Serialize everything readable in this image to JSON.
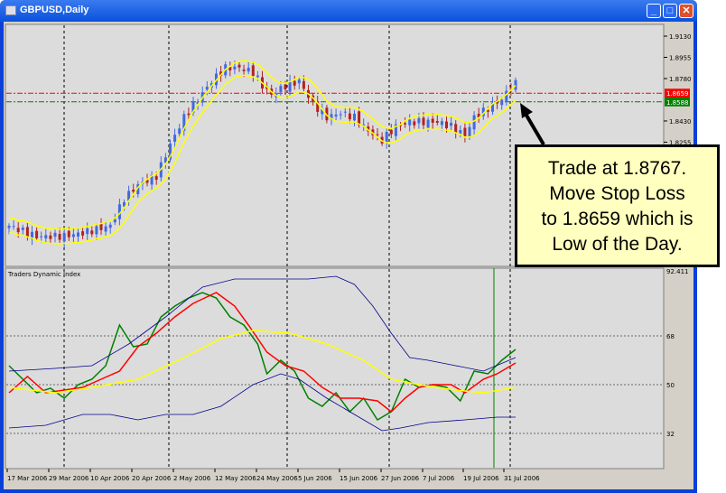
{
  "window": {
    "title": "GBPUSD,Daily",
    "buttons": [
      "minimize",
      "maximize",
      "close"
    ]
  },
  "price_axis": {
    "ticks": [
      "1.9130",
      "1.8955",
      "1.8780",
      "1.8430",
      "1.8255"
    ],
    "tick_values": [
      1.913,
      1.8955,
      1.878,
      1.843,
      1.8255
    ],
    "bid_label": "1.8659",
    "stop_label": "1.8588",
    "bid_color": "#ff0000",
    "stop_color": "#008000"
  },
  "indicator": {
    "name": "Traders Dynamic Index",
    "max_label": "92.411",
    "levels": [
      "68",
      "50",
      "32"
    ],
    "level_values": [
      68,
      50,
      32
    ]
  },
  "date_axis": [
    "17 Mar 2006",
    "29 Mar 2006",
    "10 Apr 2006",
    "20 Apr 2006",
    "2 May 2006",
    "12 May 2006",
    "24 May 2006",
    "5 Jun 2006",
    "15 Jun 2006",
    "27 Jun 2006",
    "7 Jul 2006",
    "19 Jul 2006",
    "31 Jul 2006"
  ],
  "callout": {
    "lines": [
      "Trade at 1.8767.",
      "Move Stop Loss",
      "to 1.8659 which is",
      "Low of the Day."
    ]
  },
  "colors": {
    "bull": "#4169e1",
    "bear": "#b22222",
    "bands": "#ffff00",
    "rsi": "#008000",
    "signal": "#ff0000",
    "market_base": "#ffff00",
    "volatility": "#00008b"
  },
  "chart_data": [
    {
      "type": "candlestick",
      "symbol": "GBPUSD",
      "timeframe": "Daily",
      "ylim": [
        1.74,
        1.92
      ],
      "close_path": [
        [
          0,
          1.7566
        ],
        [
          6,
          1.7476
        ],
        [
          12,
          1.748
        ],
        [
          16,
          1.7506
        ],
        [
          22,
          1.7566
        ],
        [
          25,
          1.7789
        ],
        [
          28,
          1.7901
        ],
        [
          32,
          1.7975
        ],
        [
          35,
          1.8236
        ],
        [
          38,
          1.846
        ],
        [
          41,
          1.8609
        ],
        [
          44,
          1.8758
        ],
        [
          47,
          1.8869
        ],
        [
          50,
          1.8869
        ],
        [
          53,
          1.8832
        ],
        [
          55,
          1.872
        ],
        [
          57,
          1.8646
        ],
        [
          60,
          1.872
        ],
        [
          63,
          1.8758
        ],
        [
          66,
          1.8571
        ],
        [
          69,
          1.846
        ],
        [
          72,
          1.8497
        ],
        [
          75,
          1.846
        ],
        [
          78,
          1.8348
        ],
        [
          81,
          1.8273
        ],
        [
          84,
          1.8385
        ],
        [
          87,
          1.8422
        ],
        [
          90,
          1.8422
        ],
        [
          93,
          1.8422
        ],
        [
          96,
          1.8385
        ],
        [
          99,
          1.8311
        ],
        [
          101,
          1.846
        ],
        [
          104,
          1.8534
        ],
        [
          107,
          1.8609
        ],
        [
          110,
          1.8767
        ]
      ]
    },
    {
      "type": "line",
      "title": "Traders Dynamic Index",
      "ylim": [
        25,
        92.411
      ],
      "series": [
        {
          "key": "rsi",
          "values": [
            [
              0,
              57
            ],
            [
              3,
              52
            ],
            [
              6,
              47
            ],
            [
              9,
              48.7
            ],
            [
              12,
              45
            ],
            [
              15,
              50
            ],
            [
              18,
              52
            ],
            [
              21,
              57
            ],
            [
              24,
              72
            ],
            [
              27,
              64
            ],
            [
              30,
              65
            ],
            [
              33,
              75
            ],
            [
              36,
              79
            ],
            [
              39,
              82
            ],
            [
              42,
              84
            ],
            [
              45,
              82
            ],
            [
              48,
              75
            ],
            [
              51,
              72
            ],
            [
              54,
              65
            ],
            [
              56,
              54
            ],
            [
              59,
              59
            ],
            [
              62,
              55
            ],
            [
              65,
              45
            ],
            [
              68,
              42
            ],
            [
              71,
              47
            ],
            [
              74,
              40
            ],
            [
              77,
              45
            ],
            [
              80,
              37
            ],
            [
              83,
              40
            ],
            [
              86,
              52
            ],
            [
              89,
              49
            ],
            [
              92,
              50
            ],
            [
              95,
              49
            ],
            [
              98,
              44
            ],
            [
              101,
              55
            ],
            [
              104,
              54
            ],
            [
              107,
              59
            ],
            [
              110,
              63
            ]
          ]
        },
        {
          "key": "signal",
          "values": [
            [
              0,
              47
            ],
            [
              4,
              53
            ],
            [
              8,
              47
            ],
            [
              12,
              48
            ],
            [
              16,
              49
            ],
            [
              20,
              52
            ],
            [
              24,
              55
            ],
            [
              28,
              64
            ],
            [
              32,
              69
            ],
            [
              36,
              75
            ],
            [
              40,
              80
            ],
            [
              45,
              84
            ],
            [
              49,
              79
            ],
            [
              52,
              72
            ],
            [
              56,
              62
            ],
            [
              60,
              57
            ],
            [
              64,
              55
            ],
            [
              68,
              49
            ],
            [
              72,
              45
            ],
            [
              76,
              45
            ],
            [
              80,
              44
            ],
            [
              83,
              40
            ],
            [
              86,
              45
            ],
            [
              89,
              49
            ],
            [
              92,
              50
            ],
            [
              96,
              50
            ],
            [
              99,
              47
            ],
            [
              103,
              52
            ],
            [
              106,
              54
            ],
            [
              110,
              58
            ]
          ]
        },
        {
          "key": "market_base",
          "values": [
            [
              0,
              49
            ],
            [
              10,
              47
            ],
            [
              18,
              49
            ],
            [
              28,
              52
            ],
            [
              38,
              60
            ],
            [
              46,
              67
            ],
            [
              53,
              70
            ],
            [
              61,
              69
            ],
            [
              69,
              65
            ],
            [
              77,
              59
            ],
            [
              83,
              52
            ],
            [
              89,
              50
            ],
            [
              97,
              48
            ],
            [
              103,
              47
            ],
            [
              110,
              49
            ]
          ]
        },
        {
          "key": "volatility_upper",
          "values": [
            [
              0,
              55
            ],
            [
              10,
              56
            ],
            [
              18,
              57
            ],
            [
              26,
              65
            ],
            [
              34,
              75
            ],
            [
              42,
              86
            ],
            [
              49,
              89
            ],
            [
              57,
              89
            ],
            [
              65,
              89
            ],
            [
              71,
              90
            ],
            [
              75,
              87
            ],
            [
              79,
              79
            ],
            [
              83,
              69
            ],
            [
              87,
              60
            ],
            [
              91,
              59
            ],
            [
              97,
              57
            ],
            [
              103,
              55
            ],
            [
              110,
              60
            ]
          ]
        },
        {
          "key": "volatility_lower",
          "values": [
            [
              0,
              34
            ],
            [
              8,
              35
            ],
            [
              16,
              39
            ],
            [
              22,
              39
            ],
            [
              28,
              37
            ],
            [
              34,
              39
            ],
            [
              40,
              39
            ],
            [
              46,
              42
            ],
            [
              53,
              50
            ],
            [
              59,
              54
            ],
            [
              63,
              52
            ],
            [
              69,
              45
            ],
            [
              75,
              39
            ],
            [
              81,
              33
            ],
            [
              85,
              34
            ],
            [
              91,
              36
            ],
            [
              99,
              37
            ],
            [
              106,
              38
            ],
            [
              110,
              38
            ]
          ]
        }
      ]
    }
  ]
}
